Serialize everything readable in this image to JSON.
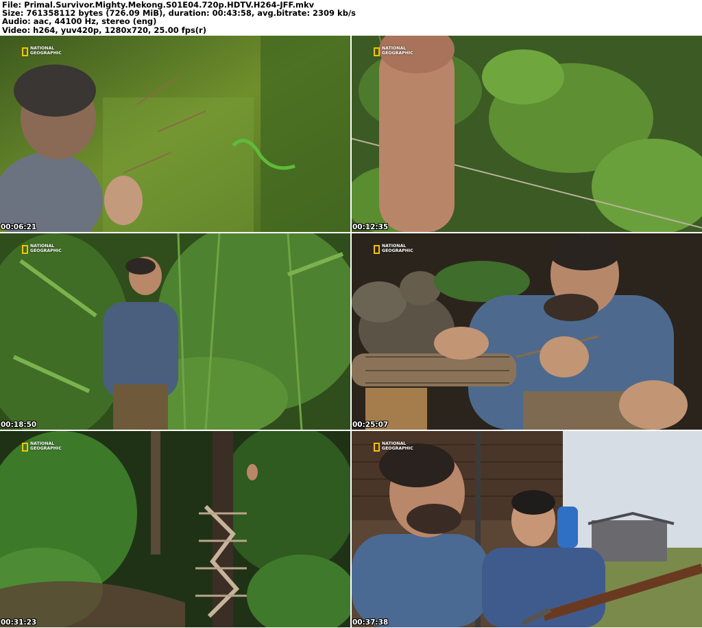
{
  "header": {
    "file": "File: Primal.Survivor.Mighty.Mekong.S01E04.720p.HDTV.H264-JFF.mkv",
    "size": "Size: 761358112 bytes (726.09 MiB), duration: 00:43:58, avg.bitrate: 2309 kb/s",
    "audio": "Audio: aac, 44100 Hz, stereo (eng)",
    "video": "Video: h264, yuv420p, 1280x720, 25.00 fps(r)"
  },
  "logo_text": "NATIONAL GEOGRAPHIC",
  "frames": [
    {
      "timestamp": "00:06:21",
      "scene": "man-examining-snake-on-moss"
    },
    {
      "timestamp": "00:12:35",
      "scene": "forearm-in-jungle-foliage"
    },
    {
      "timestamp": "00:18:50",
      "scene": "man-looking-up-in-bamboo"
    },
    {
      "timestamp": "00:25:07",
      "scene": "man-wrapping-leaf-bundle"
    },
    {
      "timestamp": "00:31:23",
      "scene": "bamboo-ladder-in-forest"
    },
    {
      "timestamp": "00:37:38",
      "scene": "men-with-rifle-at-hut"
    }
  ],
  "colors": {
    "logo_yellow": "#f5c400"
  }
}
